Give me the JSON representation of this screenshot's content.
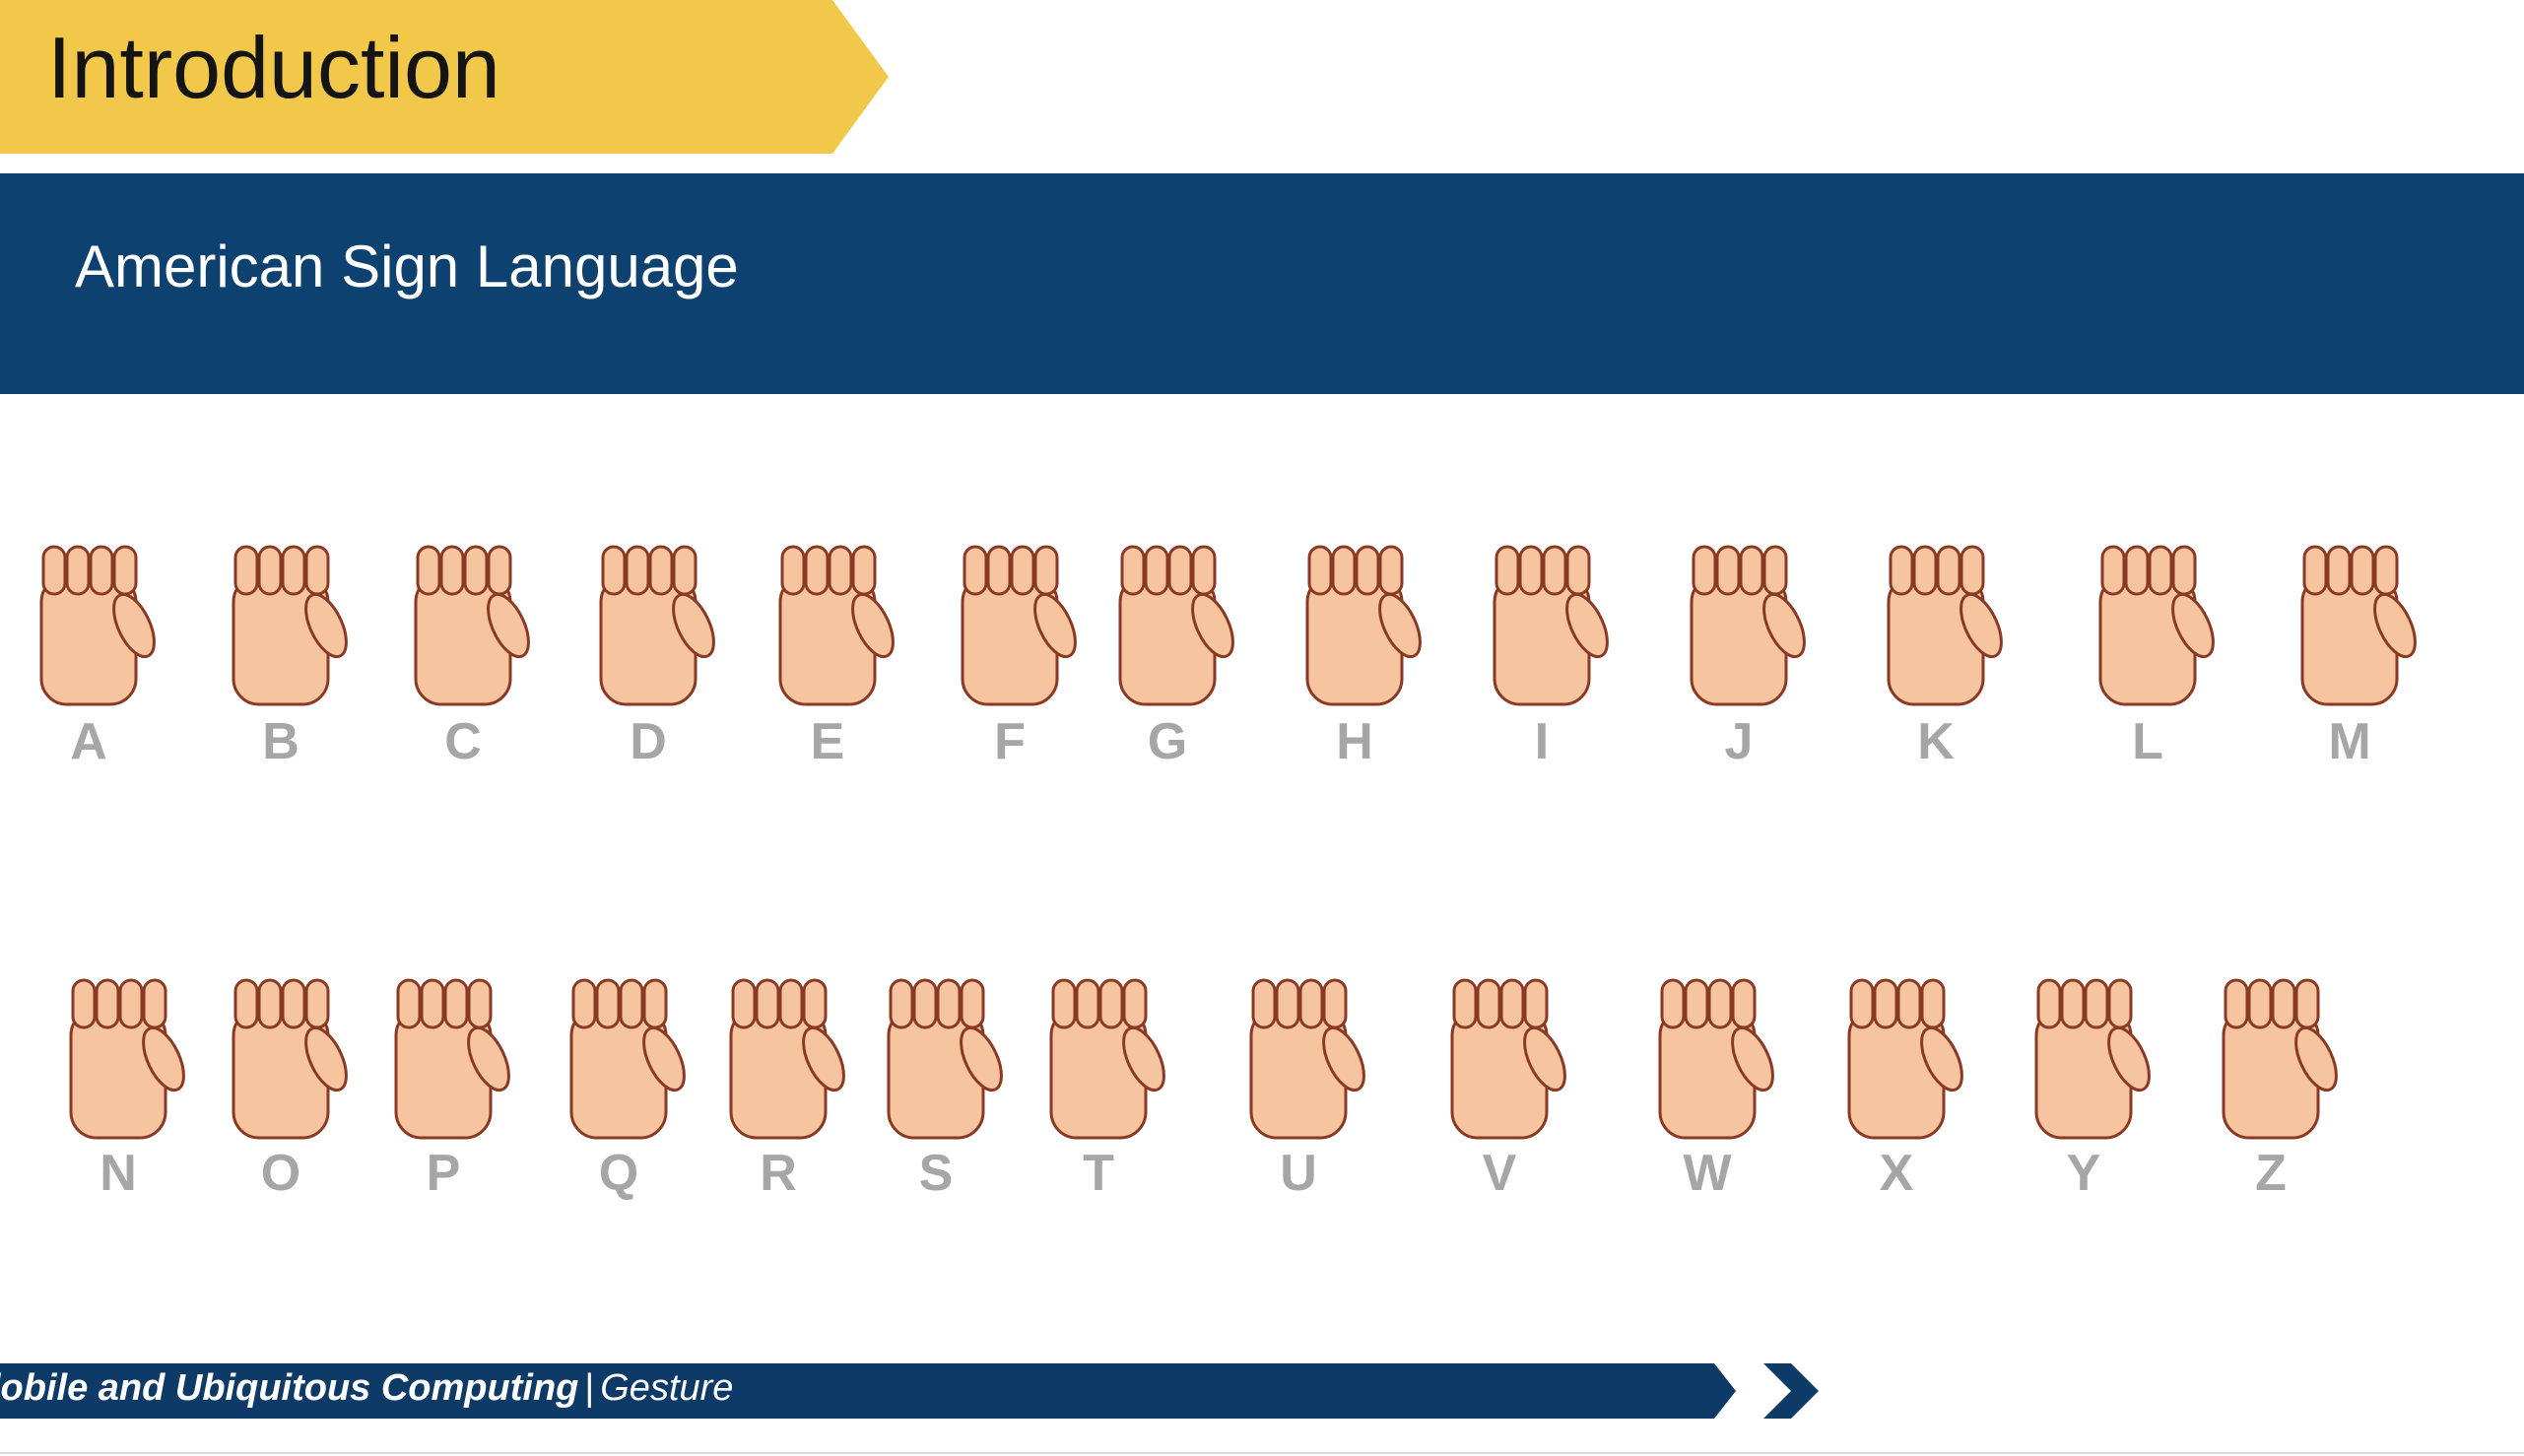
{
  "slide": {
    "title": "Introduction",
    "subtitle": "American Sign Language"
  },
  "alphabet": {
    "rows": [
      [
        "A",
        "B",
        "C",
        "D",
        "E",
        "F",
        "G",
        "H",
        "I",
        "J",
        "K",
        "L",
        "M"
      ],
      [
        "N",
        "O",
        "P",
        "Q",
        "R",
        "S",
        "T",
        "U",
        "V",
        "W",
        "X",
        "Y",
        "Z"
      ]
    ]
  },
  "footer": {
    "course": "lobile and Ubiquitous Computing",
    "separator": "|",
    "topic": "Gesture"
  },
  "colors": {
    "title_tab": "#f2c84b",
    "banner": "#0d4170",
    "footer": "#0d3a66",
    "skin": "#f7c4a0",
    "outline": "#8a3a24",
    "letter": "#a6a6a6"
  }
}
